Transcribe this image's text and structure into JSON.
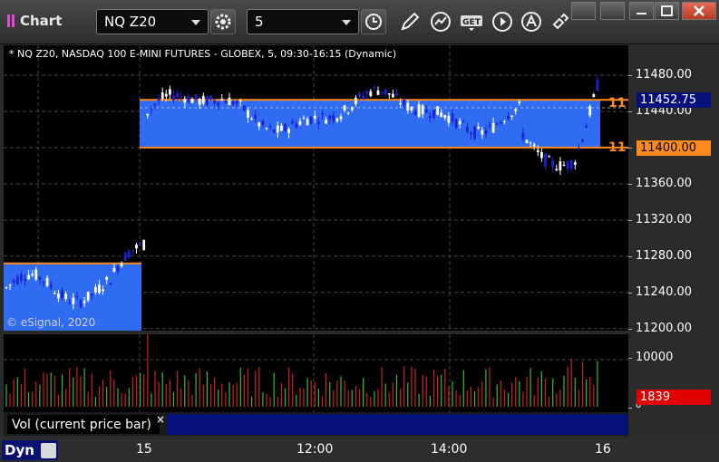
{
  "window": {
    "title": "Chart",
    "symbol_value": "NQ Z20",
    "interval_value": "5"
  },
  "chart": {
    "description": "* NQ Z20, NASDAQ 100 E-MINI FUTURES - GLOBEX, 5, 09:30-16:15 (Dynamic)",
    "copyright": "© eSignal, 2020",
    "price_ticks": [
      "11480.00",
      "11440.00",
      "11400.00",
      "11360.00",
      "11320.00",
      "11280.00",
      "11240.00",
      "11200.00"
    ],
    "last_price": "11452.75",
    "level_price": "11400.00",
    "level_marker": "11",
    "colors": {
      "up": "#ffffff",
      "down": "#1a22d8",
      "zone": "#2f6cf2",
      "level": "#ff8a1e",
      "background": "#000000"
    }
  },
  "volume": {
    "ticks": [
      "10000",
      "0"
    ],
    "last_volume": "1839",
    "legend": "Vol (current price bar)",
    "close_symbol": "×"
  },
  "time_axis": {
    "labels": [
      "15",
      "12:00",
      "14:00",
      "16"
    ],
    "mode": "Dyn"
  }
}
